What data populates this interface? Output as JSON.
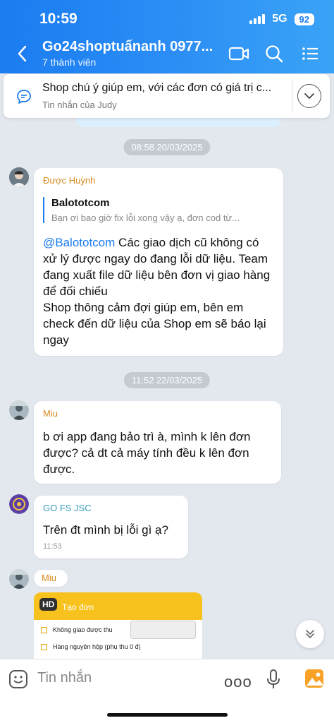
{
  "status": {
    "time": "10:59",
    "network": "5G",
    "battery": "92"
  },
  "header": {
    "title": "Go24shoptuấnanh 0977...",
    "subtitle": "7 thành viên"
  },
  "pinned": {
    "text": "Shop chú ý giúp em, với các đơn có giá trị c...",
    "sender": "Tin nhắn của Judy"
  },
  "timestamps": {
    "first": "08:58 20/03/2025",
    "second": "11:52 22/03/2025"
  },
  "messages": {
    "m1": {
      "sender": "Được Huỳnh",
      "quote_name": "Balototcom",
      "quote_text": "Bạn ơi bao giờ fix lỗi xong vậy ạ,  đơn cod từ...",
      "mention": "@Balototcom",
      "body": " Các giao dịch cũ không có xử lý được ngay do đang lỗi dữ liệu. Team đang xuất file dữ liệu bên đơn vị giao hàng để đối chiếu\nShop thông cảm đợi giúp em, bên em check đến dữ liệu của Shop em sẽ báo lại ngay"
    },
    "m2": {
      "sender": "Miu",
      "body": "b ơi app đang bảo trì à, mình k lên đơn được? cả dt cả máy tính đều k lên đơn được."
    },
    "m3": {
      "sender": "GO FS JSC",
      "body": "Trên đt mình bị lỗi gì ạ?",
      "time": "11:53"
    },
    "m4": {
      "sender": "Miu"
    }
  },
  "form_card": {
    "badge": "HD",
    "title": "Tạo đơn",
    "rows": [
      "Không giao được thu",
      "Hàng nguyên hộp (phụ thu 0 đ)"
    ]
  },
  "composer": {
    "placeholder": "Tin nhắn",
    "more": "ooo"
  },
  "colors": {
    "header": "#1a7cf0",
    "accent": "#1a7cf0",
    "sender_orange": "#d98a1e",
    "sender_teal": "#3a9dbb",
    "card_yellow": "#f7c21d"
  }
}
